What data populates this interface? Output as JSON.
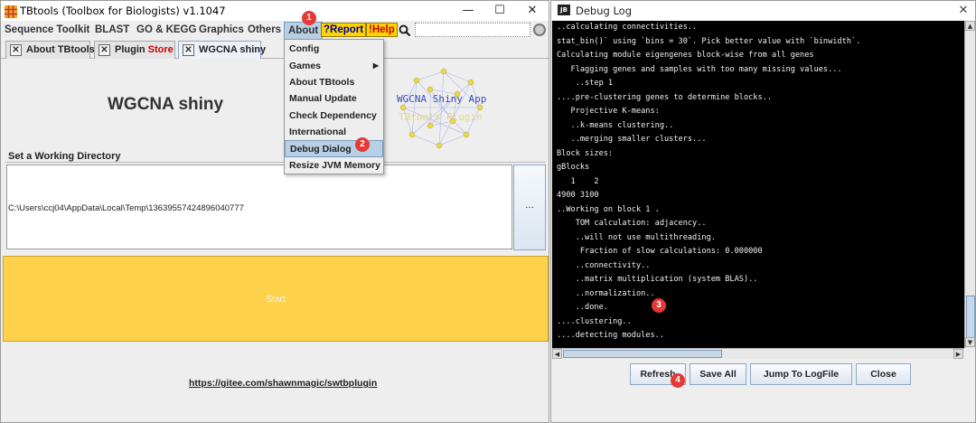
{
  "left_window": {
    "title": "TBtools (Toolbox for Biologists) v1.1047",
    "controls": {
      "minimize": "—",
      "maximize": "☐",
      "close": "✕"
    },
    "menubar": {
      "items": [
        "Sequence Toolkit",
        "BLAST",
        "GO & KEGG",
        "Graphics",
        "Others",
        "About"
      ],
      "report": "?Report",
      "help": "!Help",
      "search_field_value": ""
    },
    "tabs": [
      {
        "label": "About TBtools"
      },
      {
        "label_prefix": "Plugin ",
        "label_suffix": "Store"
      },
      {
        "label": "WGCNA shiny"
      }
    ],
    "main": {
      "title": "WGCNA shiny",
      "logo_line_1": "WGCNA Shiny App",
      "logo_line_2": "TBtools Plugin",
      "section_label": "Set a Working Directory",
      "directory_path": "C:\\Users\\ccj04\\AppData\\Local\\Temp\\13639557424896040777",
      "browse_label": "...",
      "start_label": "Start",
      "plugin_link": "https://gitee.com/shawnmagic/swtbplugin"
    },
    "about_menu": {
      "items": [
        "Config",
        "Games",
        "About TBtools",
        "Manual Update",
        "Check Dependency",
        "International",
        "Debug Dialog",
        "Resize JVM Memory"
      ],
      "highlighted": "Debug Dialog"
    }
  },
  "right_window": {
    "title": "Debug Log",
    "icon_label": "JB",
    "close_symbol": "✕",
    "log_lines": [
      "..calculating connectivities..",
      "stat_bin()` using `bins = 30`. Pick better value with `binwidth`.",
      "Calculating module eigengenes block-wise from all genes",
      "   Flagging genes and samples with too many missing values...",
      "    ..step 1",
      "....pre-clustering genes to determine blocks..",
      "   Projective K-means:",
      "   ..k-means clustering..",
      "   ..merging smaller clusters...",
      "Block sizes:",
      "gBlocks",
      "   1    2",
      "4900 3100",
      "..Working on block 1 .",
      "    TOM calculation: adjacency..",
      "    ..will not use multithreading.",
      "     Fraction of slow calculations: 0.000000",
      "    ..connectivity..",
      "    ..matrix multiplication (system BLAS)..",
      "    ..normalization..",
      "    ..done.",
      "....clustering..",
      "....detecting modules.."
    ],
    "buttons": {
      "refresh": "Refresh",
      "save_all": "Save All",
      "jump_to_logfile": "Jump To LogFile",
      "close": "Close"
    }
  },
  "markers": [
    "1",
    "2",
    "3",
    "4"
  ],
  "colors": {
    "accent_yellow": "#fdd24a",
    "marker_red": "#e53935",
    "menu_highlight": "#b8cfe5",
    "log_bg": "#000000",
    "store_red": "#cc0000"
  }
}
